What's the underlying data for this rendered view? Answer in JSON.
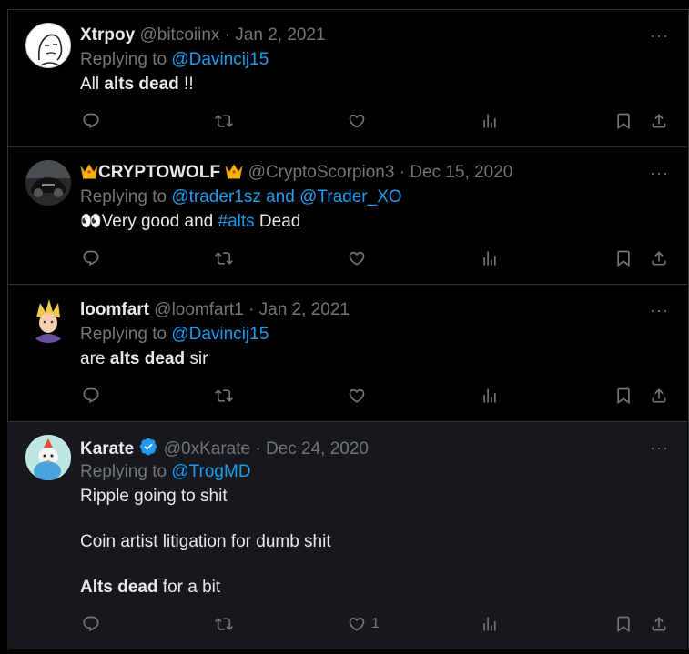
{
  "tweets": [
    {
      "name": "Xtrpoy",
      "handle": "@bitcoiinx",
      "sep": "·",
      "date": "Jan 2, 2021",
      "replying_prefix": "Replying to",
      "replying_to": "@Davincij15",
      "body": [
        [
          "All ",
          "alts dead",
          " !!"
        ]
      ],
      "likes": ""
    },
    {
      "name": "CRYPTOWOLF",
      "handle": "@CryptoScorpion3",
      "sep": "·",
      "date": "Dec 15, 2020",
      "replying_prefix": "Replying to",
      "replying_to": "@trader1sz and @Trader_XO",
      "body_emoji": "👀",
      "body_text1": "Very good and ",
      "body_tag": "#alts",
      "body_text2": " Dead",
      "likes": ""
    },
    {
      "name": "loomfart",
      "handle": "@loomfart1",
      "sep": "·",
      "date": "Jan 2, 2021",
      "replying_prefix": "Replying to",
      "replying_to": "@Davincij15",
      "body": [
        [
          "are ",
          "alts dead",
          " sir"
        ]
      ],
      "likes": ""
    },
    {
      "name": "Karate",
      "handle": "@0xKarate",
      "sep": "·",
      "date": "Dec 24, 2020",
      "replying_prefix": "Replying to",
      "replying_to": "@TrogMD",
      "line1": "Ripple going to shit",
      "line2": "Coin artist litigation for dumb shit",
      "line3_bold": "Alts dead",
      "line3_rest": " for a bit",
      "likes": "1"
    }
  ],
  "more_label": "···",
  "icons": [
    "reply-icon",
    "retweet-icon",
    "like-icon",
    "views-icon",
    "bookmark-icon",
    "share-icon"
  ],
  "colors": {
    "link": "#1d9bf0",
    "muted": "#71767b",
    "verified": "#1d9bf0",
    "highlight_bg": "#16181c"
  }
}
